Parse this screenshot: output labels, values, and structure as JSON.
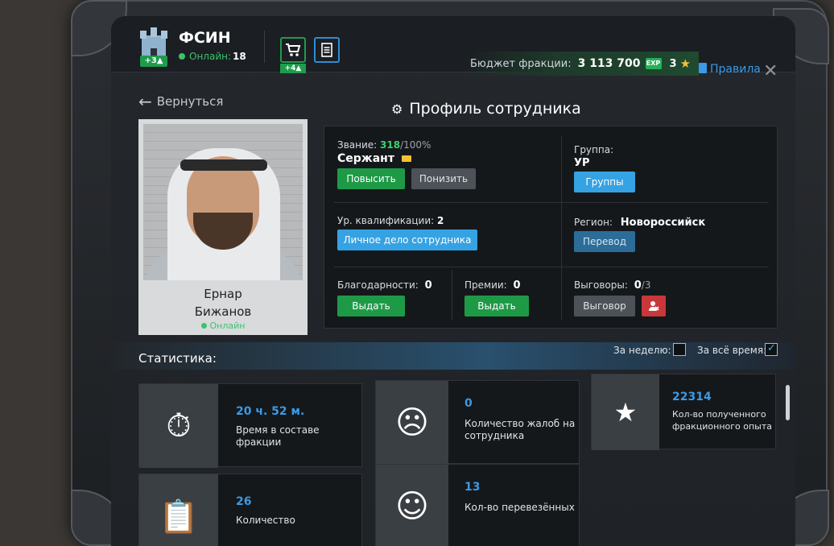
{
  "header": {
    "faction_name": "ФСИН",
    "faction_badge": "+3▲",
    "online_label": "Онлайн:",
    "online_count": "18",
    "cart_badge": "+4▲",
    "budget_label": "Бюджет фракции:",
    "budget_value": "3 113 700",
    "money_icon_text": "EXP",
    "stars_count": "3",
    "rules_label": "Правила",
    "close_label": "✕"
  },
  "nav": {
    "back_label": "Вернуться",
    "page_title": "Профиль сотрудника"
  },
  "employee": {
    "first_name": "Ернар",
    "last_name": "Бижанов",
    "status": "Онлайн"
  },
  "profile": {
    "rank_label": "Звание:",
    "rank_points": "318",
    "rank_max": "/100%",
    "rank_name": "Сержант",
    "promote_label": "Повысить",
    "demote_label": "Понизить",
    "group_label": "Группа:",
    "group_value": "УР",
    "groups_button": "Группы",
    "qual_label": "Ур. квалификации:",
    "qual_value": "2",
    "personal_file_button": "Личное дело сотрудника",
    "region_label": "Регион:",
    "region_value": "Новороссийск",
    "transfer_button": "Перевод",
    "thanks_label": "Благодарности:",
    "thanks_value": "0",
    "give_thanks_button": "Выдать",
    "bonus_label": "Премии:",
    "bonus_value": "0",
    "give_bonus_button": "Выдать",
    "reprimand_label": "Выговоры:",
    "reprimand_value": "0",
    "reprimand_max": "/3",
    "reprimand_button": "Выговор"
  },
  "stats": {
    "title": "Статистика:",
    "week_label": "За неделю:",
    "all_time_label": "За всё время:",
    "cards": [
      {
        "value": "20 ч. 52 м.",
        "desc": "Время в составе фракции",
        "icon": "stopwatch-icon"
      },
      {
        "value": "0",
        "desc": "Количество жалоб на сотрудника",
        "icon": "complaint-icon"
      },
      {
        "value": "22314",
        "desc": "Кол-во полученного фракционного опыта",
        "icon": "exp-stars-icon"
      },
      {
        "value": "26",
        "desc": "Количество",
        "icon": "checklist-icon"
      },
      {
        "value": "13",
        "desc": "Кол-во перевезённых",
        "icon": "prisoner-icon"
      }
    ]
  }
}
